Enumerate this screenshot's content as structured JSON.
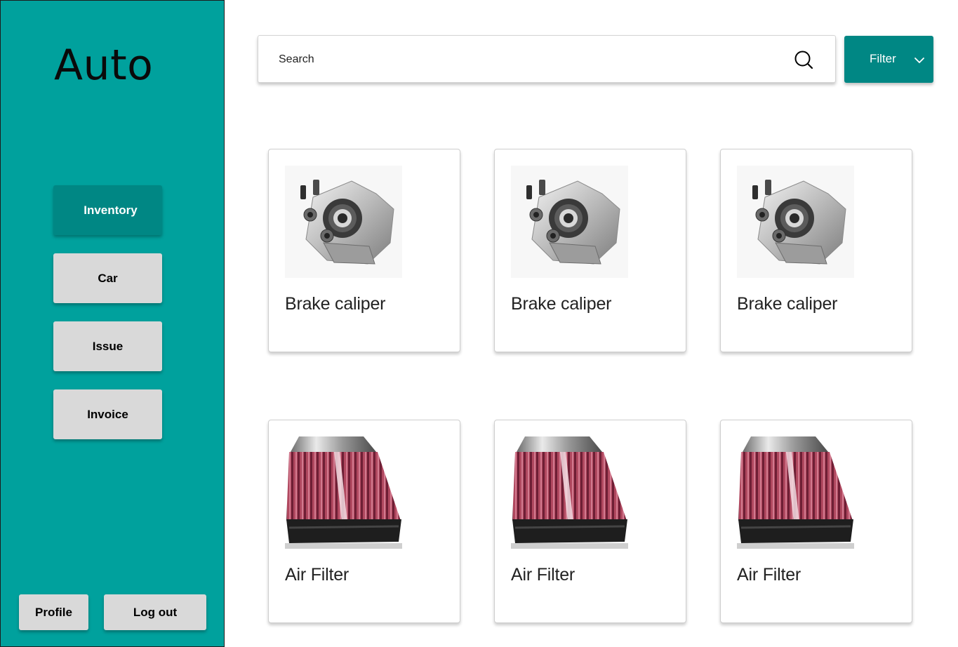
{
  "sidebar": {
    "brand": "Auto",
    "nav": [
      {
        "label": "Inventory",
        "active": true
      },
      {
        "label": "Car",
        "active": false
      },
      {
        "label": "Issue",
        "active": false
      },
      {
        "label": "Invoice",
        "active": false
      }
    ],
    "footer": {
      "profile_label": "Profile",
      "logout_label": "Log out"
    }
  },
  "topbar": {
    "search": {
      "placeholder": "Search",
      "value": "",
      "icon": "search-icon"
    },
    "filter": {
      "label": "Filter",
      "icon": "chevron-down-icon"
    }
  },
  "products": [
    {
      "name": "Brake caliper",
      "image": "brake-caliper"
    },
    {
      "name": "Brake caliper",
      "image": "brake-caliper"
    },
    {
      "name": "Brake caliper",
      "image": "brake-caliper"
    },
    {
      "name": "Air Filter",
      "image": "air-filter"
    },
    {
      "name": "Air Filter",
      "image": "air-filter"
    },
    {
      "name": "Air Filter",
      "image": "air-filter"
    }
  ],
  "colors": {
    "sidebar_bg": "#00a19d",
    "accent": "#008784",
    "button_gray": "#d9d9d9"
  }
}
